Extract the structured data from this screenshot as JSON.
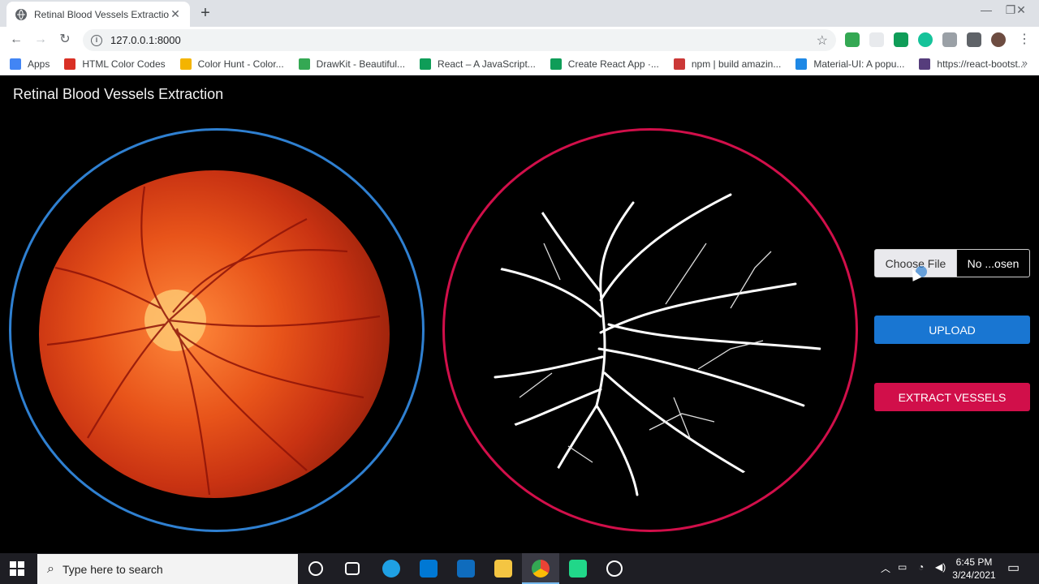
{
  "browser": {
    "tab_title": "Retinal Blood Vessels Extraction",
    "url": "127.0.0.1:8000",
    "bookmarks": [
      {
        "label": "Apps",
        "icon": "apps-grid-icon",
        "color": "#4285f4"
      },
      {
        "label": "HTML Color Codes",
        "icon": "html-color-codes-icon",
        "color": "#d93025"
      },
      {
        "label": "Color Hunt - Color...",
        "icon": "color-hunt-icon",
        "color": "#f4b400"
      },
      {
        "label": "DrawKit - Beautiful...",
        "icon": "drawkit-icon",
        "color": "#34a853"
      },
      {
        "label": "React – A JavaScript...",
        "icon": "react-icon",
        "color": "#0f9d58"
      },
      {
        "label": "Create React App ·...",
        "icon": "create-react-app-icon",
        "color": "#0f9d58"
      },
      {
        "label": "npm | build amazin...",
        "icon": "npm-icon",
        "color": "#cb3837"
      },
      {
        "label": "Material-UI: A popu...",
        "icon": "material-ui-icon",
        "color": "#1e88e5"
      },
      {
        "label": "https://react-bootst...",
        "icon": "react-bootstrap-icon",
        "color": "#563d7c"
      }
    ]
  },
  "page": {
    "title": "Retinal Blood Vessels Extraction",
    "file_button": "Choose File",
    "file_name": "No ...osen",
    "upload_button": "UPLOAD",
    "extract_button": "EXTRACT VESSELS",
    "accent_blue": "#2f80d1",
    "accent_red": "#d10f4a"
  },
  "taskbar": {
    "search_placeholder": "Type here to search",
    "time": "6:45 PM",
    "date": "3/24/2021"
  }
}
